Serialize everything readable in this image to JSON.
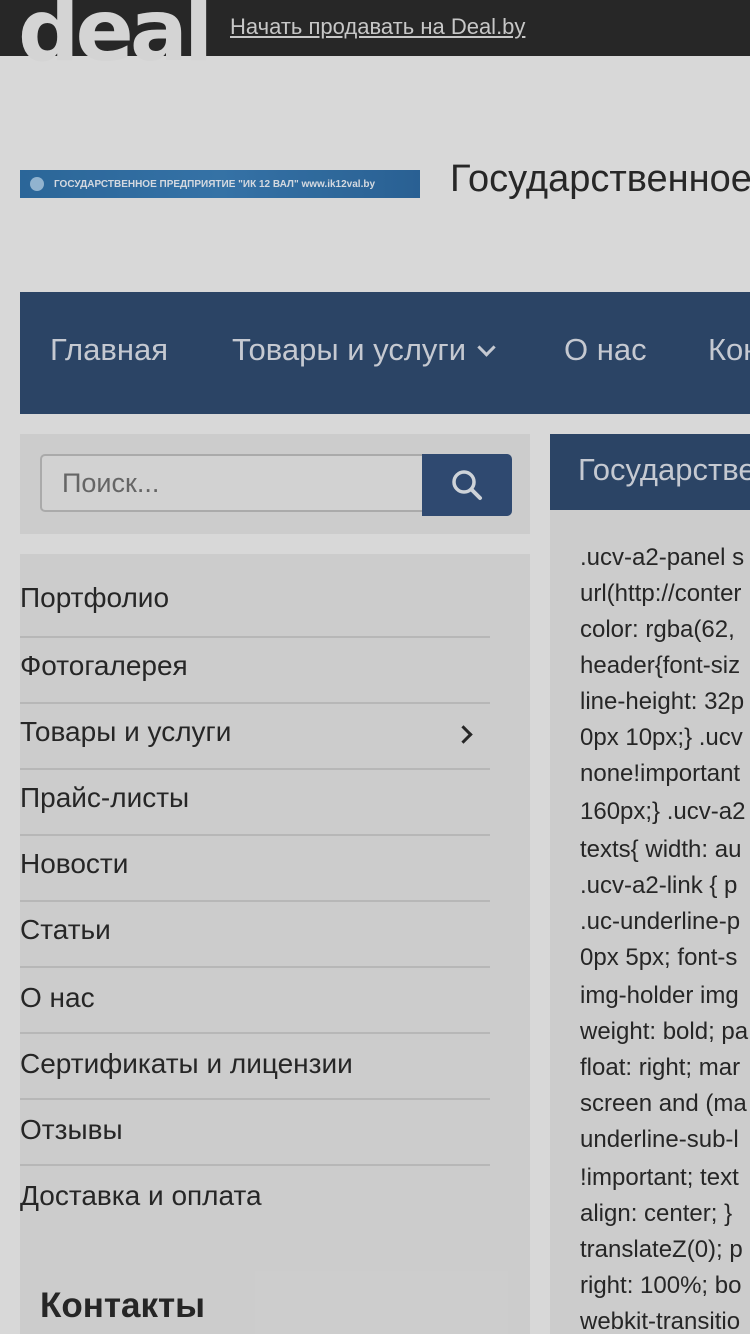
{
  "topbar": {
    "logo": "deal",
    "sell_link": "Начать продавать на Deal.by"
  },
  "header": {
    "banner_text": "ГОСУДАРСТВЕННОЕ ПРЕДПРИЯТИЕ \"ИК 12 ВАЛ\"   www.ik12val.by",
    "company_title": "Государственное"
  },
  "nav": {
    "items": [
      {
        "label": "Главная"
      },
      {
        "label": "Товары и услуги"
      },
      {
        "label": "О нас"
      },
      {
        "label": "Контакты"
      }
    ]
  },
  "search": {
    "placeholder": "Поиск..."
  },
  "sidebar": {
    "items": [
      {
        "label": "Портфолио"
      },
      {
        "label": "Фотогалерея"
      },
      {
        "label": "Товары и услуги"
      },
      {
        "label": "Прайс-листы"
      },
      {
        "label": "Новости"
      },
      {
        "label": "Статьи"
      },
      {
        "label": "О нас"
      },
      {
        "label": "Сертификаты и лицензии"
      },
      {
        "label": "Отзывы"
      },
      {
        "label": "Доставка и оплата"
      }
    ],
    "contacts_heading": "Контакты"
  },
  "content": {
    "title": "Государственное",
    "code_lines": [
      ".ucv-a2-panel s",
      "url(http://conter",
      "color: rgba(62,",
      "header{font-siz",
      "line-height: 32p",
      "0px 10px;} .ucv",
      "none!important",
      "160px;} .ucv-a2",
      "texts{ width: au",
      ".ucv-a2-link { p",
      ".uc-underline-p",
      "0px 5px; font-s",
      "img-holder img",
      "weight: bold; pa",
      "float: right; mar",
      "screen and (ma",
      "underline-sub-l",
      "!important; text",
      "align: center; }",
      "translateZ(0); p",
      "right: 100%; bo",
      "webkit-transitio"
    ]
  }
}
